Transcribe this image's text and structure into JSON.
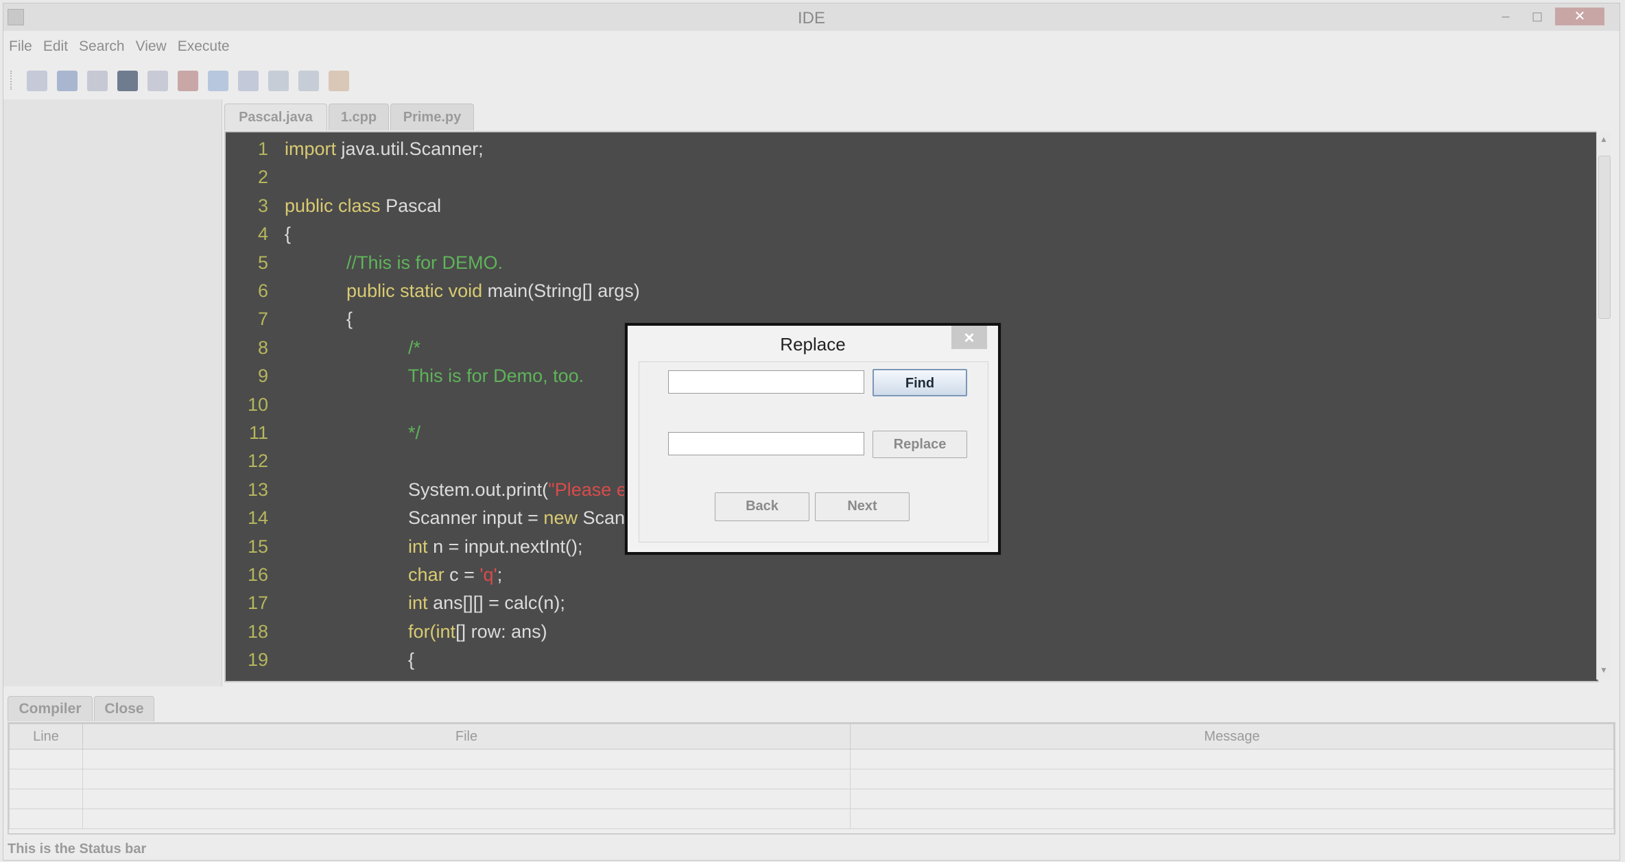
{
  "window": {
    "title": "IDE",
    "minimize": "–",
    "maximize": "◻",
    "close": "✕"
  },
  "menu": [
    "File",
    "Edit",
    "Search",
    "View",
    "Execute"
  ],
  "toolbar_icons": [
    "new-file-icon",
    "open-file-icon",
    "save-icon",
    "save-all-icon",
    "print-icon",
    "close-file-icon",
    "undo-icon",
    "redo-icon",
    "refresh-icon",
    "compile-icon",
    "run-icon"
  ],
  "editor_tabs": [
    "Pascal.java",
    "1.cpp",
    "Prime.py"
  ],
  "code": [
    [
      {
        "t": "import",
        "c": "kw"
      },
      {
        "t": " java.util.Scanner;",
        "c": ""
      }
    ],
    [],
    [
      {
        "t": "public class",
        "c": "kw"
      },
      {
        "t": " Pascal",
        "c": ""
      }
    ],
    [
      {
        "t": "{",
        "c": ""
      }
    ],
    [
      {
        "t": "            ",
        "c": ""
      },
      {
        "t": "//This is for DEMO.",
        "c": "cm"
      }
    ],
    [
      {
        "t": "            ",
        "c": ""
      },
      {
        "t": "public static void",
        "c": "kw"
      },
      {
        "t": " main(String[] args)",
        "c": ""
      }
    ],
    [
      {
        "t": "            {",
        "c": ""
      }
    ],
    [
      {
        "t": "                        ",
        "c": ""
      },
      {
        "t": "/*",
        "c": "cm"
      }
    ],
    [
      {
        "t": "                        ",
        "c": ""
      },
      {
        "t": "This is for Demo, too.",
        "c": "cm"
      }
    ],
    [],
    [
      {
        "t": "                        ",
        "c": ""
      },
      {
        "t": "*/",
        "c": "cm"
      }
    ],
    [],
    [
      {
        "t": "                        System.out.print(",
        "c": ""
      },
      {
        "t": "\"Please enter n: \"",
        "c": "st"
      },
      {
        "t": ");",
        "c": ""
      }
    ],
    [
      {
        "t": "                        Scanner input = ",
        "c": ""
      },
      {
        "t": "new",
        "c": "kw"
      },
      {
        "t": " Scanner(System.in);",
        "c": ""
      }
    ],
    [
      {
        "t": "                        ",
        "c": ""
      },
      {
        "t": "int",
        "c": "kw"
      },
      {
        "t": " n = input.nextInt();",
        "c": ""
      }
    ],
    [
      {
        "t": "                        ",
        "c": ""
      },
      {
        "t": "char",
        "c": "kw"
      },
      {
        "t": " c = ",
        "c": ""
      },
      {
        "t": "'q'",
        "c": "st"
      },
      {
        "t": ";",
        "c": ""
      }
    ],
    [
      {
        "t": "                        ",
        "c": ""
      },
      {
        "t": "int",
        "c": "kw"
      },
      {
        "t": " ans[][] = calc(n);",
        "c": ""
      }
    ],
    [
      {
        "t": "                        ",
        "c": ""
      },
      {
        "t": "for(",
        "c": "kw"
      },
      {
        "t": "int",
        "c": "kw"
      },
      {
        "t": "[] row: ans)",
        "c": ""
      }
    ],
    [
      {
        "t": "                        {",
        "c": ""
      }
    ]
  ],
  "bottom_tabs": [
    "Compiler",
    "Close"
  ],
  "table": {
    "columns": [
      "Line",
      "File",
      "Message"
    ],
    "rows": 4
  },
  "status": "This is the Status bar",
  "dialog": {
    "title": "Replace",
    "close": "×",
    "find_value": "",
    "replace_value": "",
    "find_button": "Find",
    "replace_button": "Replace",
    "back_button": "Back",
    "next_button": "Next"
  }
}
